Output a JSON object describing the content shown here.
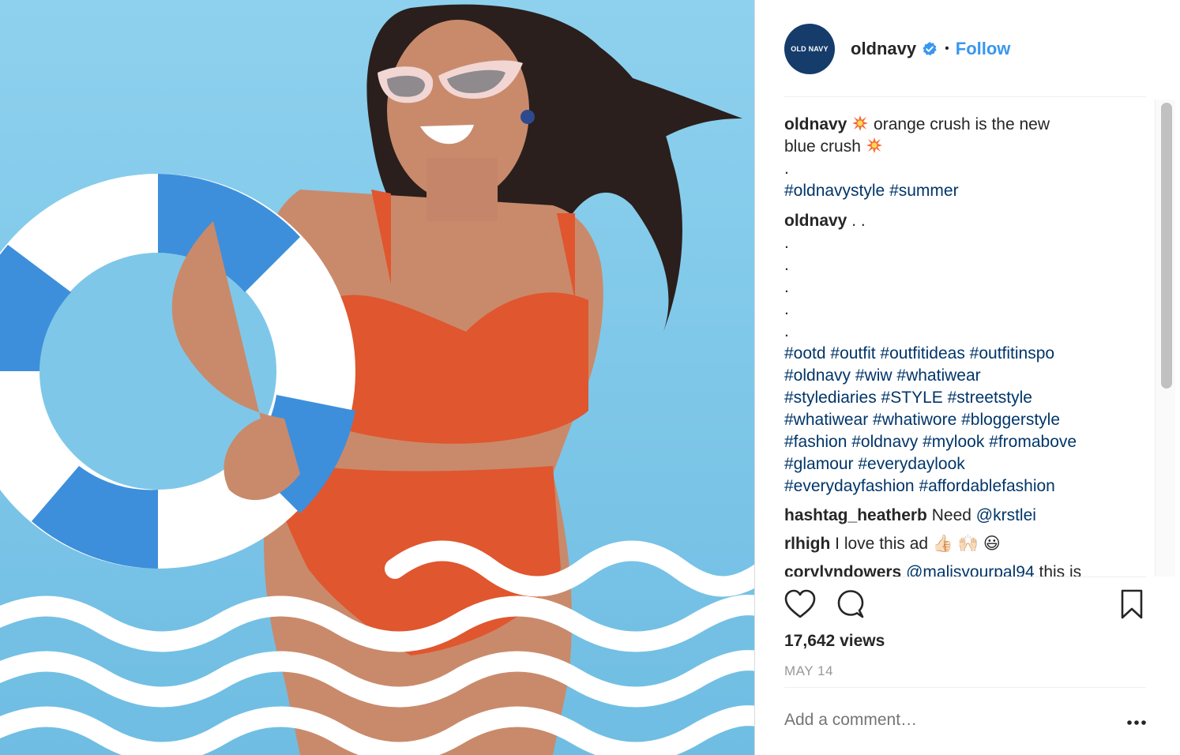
{
  "post": {
    "username": "oldnavy",
    "avatar_text": "OLD NAVY",
    "separator": "•",
    "follow_label": "Follow",
    "verified_icon": "verified-badge-icon",
    "colors": {
      "accent": "#3897f0",
      "hashtag": "#003569",
      "avatar": "#153c6a"
    }
  },
  "caption": {
    "username": "oldnavy",
    "line1": "orange crush is the new",
    "line2": "blue crush",
    "dot": ".",
    "tags": "#oldnavystyle #summer"
  },
  "hashtag_comment": {
    "username": "oldnavy",
    "after_user": ". .",
    "dots": [
      ".",
      ".",
      ".",
      ".",
      "."
    ],
    "tag_lines": [
      "#ootd #outfit #outfitideas #outfitinspo",
      "#oldnavy #wiw #whatiwear",
      "#stylediaries #STYLE #streetstyle",
      "#whatiwear #whatiwore #bloggerstyle",
      "#fashion #oldnavy #mylook #fromabove",
      "#glamour #everydaylook",
      "#everydayfashion #affordablefashion"
    ]
  },
  "comments": [
    {
      "username": "hashtag_heatherb",
      "text": "Need",
      "mention": "@krstlei"
    },
    {
      "username": "rlhigh",
      "text": "I love this ad",
      "emoji": "👍🏻 🙌🏻 😃"
    },
    {
      "username": "corylyndowers",
      "mention": "@malisyourpal94",
      "text": "this is"
    }
  ],
  "stats": {
    "views": "17,642 views",
    "date": "MAY 14"
  },
  "actions": {
    "like": "heart-icon",
    "comment": "comment-bubble-icon",
    "save": "bookmark-icon",
    "more": "more-dots-icon"
  },
  "composer": {
    "placeholder": "Add a comment…"
  }
}
